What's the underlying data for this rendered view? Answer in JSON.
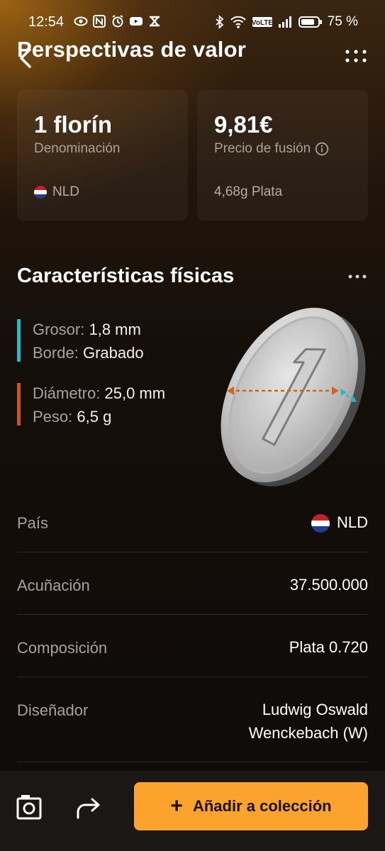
{
  "status_bar": {
    "time": "12:54",
    "battery_percent": "75 %",
    "icons_left": [
      "eye-icon",
      "nfc-icon",
      "alarm-icon",
      "youtube-icon",
      "app-icon"
    ],
    "icons_right": [
      "bluetooth-icon",
      "wifi-icon",
      "volte-icon",
      "signal-icon",
      "battery-icon"
    ]
  },
  "header": {
    "title": "Perspectivas de valor"
  },
  "cards": [
    {
      "value": "1 florín",
      "label": "Denominación",
      "foot": "NLD"
    },
    {
      "value": "9,81€",
      "label": "Precio de fusión",
      "foot": "4,68g Plata"
    }
  ],
  "physical": {
    "title": "Características físicas",
    "groups": [
      {
        "color": "#2bb7c9",
        "specs": [
          {
            "key": "Grosor:",
            "value": "1,8 mm"
          },
          {
            "key": "Borde:",
            "value": "Grabado"
          }
        ]
      },
      {
        "color": "#c8541e",
        "specs": [
          {
            "key": "Diámetro:",
            "value": "25,0 mm"
          },
          {
            "key": "Peso:",
            "value": "6,5 g"
          }
        ]
      }
    ]
  },
  "details": [
    {
      "key": "País",
      "value": "NLD"
    },
    {
      "key": "Acuñación",
      "value": "37.500.000"
    },
    {
      "key": "Composición",
      "value": "Plata 0.720"
    },
    {
      "key": "Diseñador",
      "value_line1": "Ludwig Oswald",
      "value_line2": "Wenckebach (W)"
    }
  ],
  "bottom_bar": {
    "add_label": "Añadir a colección"
  },
  "colors": {
    "accent": "#fca32e",
    "thickness_marker": "#2bb7c9",
    "diameter_marker": "#c8541e"
  }
}
